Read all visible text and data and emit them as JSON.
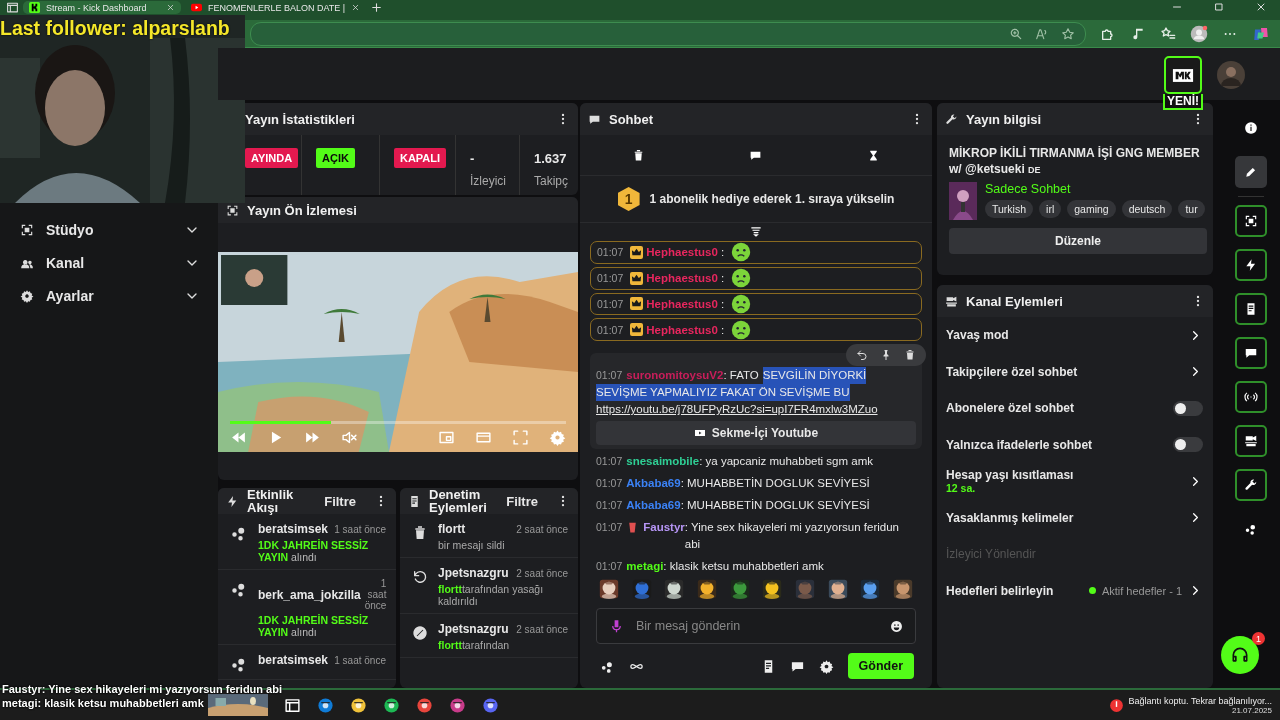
{
  "browser": {
    "tabs": [
      {
        "title": "Stream - Kick Dashboard",
        "selected": true
      },
      {
        "title": "FENOMENLERLE BALON DATE |",
        "selected": false
      }
    ]
  },
  "webcam_overlay": {
    "caption": "Last follower: alparslanb"
  },
  "header": {
    "new_badge": "YENİ!"
  },
  "sidebar": {
    "items": [
      {
        "label": "Stüdyo",
        "expanded": false
      },
      {
        "label": "Kanal",
        "expanded": false
      },
      {
        "label": "Ayarlar",
        "expanded": false
      }
    ]
  },
  "stats": {
    "title": "Yayın İstatistikleri",
    "items": [
      {
        "kind": "badge",
        "value": "AYINDA",
        "color": "#e3194f"
      },
      {
        "kind": "badge",
        "value": "AÇIK",
        "color": "#53fc18"
      },
      {
        "kind": "badge",
        "value": "KAPALI",
        "color": "#e3194f"
      },
      {
        "kind": "text",
        "value": "-",
        "label": "İzleyici"
      },
      {
        "kind": "text",
        "value": "1.637",
        "label": "Takipç"
      }
    ]
  },
  "preview": {
    "title": "Yayın Ön İzlemesi",
    "progress": {
      "level": 0.3
    }
  },
  "events": {
    "title": "Etkinlik Akışı",
    "filter": "Filtre",
    "items": [
      {
        "user": "beratsimsek",
        "time": "1 saat önce",
        "reward": "1DK JAHREİN SESSİZ YAYIN",
        "action": "alındı"
      },
      {
        "user": "berk_ama_jokzilla",
        "time": "1 saat önce",
        "reward": "1DK JAHREİN SESSİZ YAYIN",
        "action": "alındı"
      },
      {
        "user": "beratsimsek",
        "time": "1 saat önce"
      }
    ]
  },
  "moderation": {
    "title": "Denetim Eylemleri",
    "filter": "Filtre",
    "items": [
      {
        "kind": "delete",
        "user": "flortt",
        "time": "2 saat önce",
        "description": "bir mesajı sildi"
      },
      {
        "kind": "unban",
        "user": "Jpetsnazgru",
        "time": "2 saat önce",
        "actor": "flortt",
        "description": "tarafından yasağı kaldırıldı"
      },
      {
        "kind": "timeout",
        "user": "Jpetsnazgru",
        "time": "2 saat önce",
        "actor": "flortt",
        "description": "tarafından"
      }
    ]
  },
  "chat": {
    "title": "Sohbet",
    "promo_rank": "1",
    "promo": "1 abonelik hediye ederek 1. sıraya yükselin",
    "messages": [
      {
        "kind": "highlighted",
        "time": "01:07",
        "badge": {
          "kind": "crown"
        },
        "user": "Hephaestus0",
        "color": "#e8265e",
        "text": ":",
        "emote": true
      },
      {
        "kind": "highlighted",
        "time": "01:07",
        "badge": {
          "kind": "crown"
        },
        "user": "Hephaestus0",
        "color": "#e8265e",
        "text": ":",
        "emote": true
      },
      {
        "kind": "highlighted",
        "time": "01:07",
        "badge": {
          "kind": "crown"
        },
        "user": "Hephaestus0",
        "color": "#e8265e",
        "text": ":",
        "emote": true
      },
      {
        "kind": "highlighted",
        "time": "01:07",
        "badge": {
          "kind": "crown"
        },
        "user": "Hephaestus0",
        "color": "#e8265e",
        "text": ":",
        "emote": true
      },
      {
        "kind": "card",
        "time": "01:07",
        "user": "suronomitoysuV2",
        "color": "#c81e5a",
        "lines": [
          [
            {
              "text": ": FATO",
              "selected": false
            },
            {
              "text": "SEVGİLİN DİYORKİ",
              "selected": true
            }
          ],
          [
            {
              "text": "SEVİŞME YAPMALIYIZ FAKAT ÖN SEVİŞME BU",
              "selected": true
            }
          ]
        ],
        "link": "https://youtu.be/j78UFPyRzUc?si=upI7FR4mxlw3MZuo",
        "button": "Sekme-İçi Youtube"
      },
      {
        "kind": "plain",
        "time": "01:07",
        "user": "snesaimobile",
        "color": "#2fcf95",
        "text": ": ya yapcaniz muhabbeti sgm amk"
      },
      {
        "kind": "plain",
        "time": "01:07",
        "user": "Akbaba69",
        "color": "#3b82f6",
        "text": ": MUHABBETİN DOGLUK SEVİYESİ"
      },
      {
        "kind": "plain",
        "time": "01:07",
        "user": "Akbaba69",
        "color": "#3b82f6",
        "text": ": MUHABBETİN DOGLUK SEVİYESİ"
      },
      {
        "kind": "plain",
        "time": "01:07",
        "badge": {
          "kind": "cup"
        },
        "user": "Faustyr",
        "color": "#b695f5",
        "text": ": Yine sex hikayeleri mi yazıyorsun feridun abi"
      },
      {
        "kind": "plain",
        "time": "01:07",
        "user": "metagi",
        "color": "#53fc18",
        "text": ": klasik ketsu muhabbetleri amk"
      }
    ],
    "placeholder": "Bir mesaj gönderin",
    "send": "Gönder"
  },
  "stream_info": {
    "title": "Yayın bilgisi",
    "stream_title": "MİKROP İKİLİ TIRMANMA İŞİ GNG MEMBER w/ @ketsueki",
    "language": "DE",
    "category": "Sadece Sohbet",
    "tags": [
      "Turkish",
      "irl",
      "gaming",
      "deutsch",
      "tur"
    ],
    "edit": "Düzenle"
  },
  "channel_actions": {
    "title": "Kanal Eylemleri",
    "items": [
      {
        "kind": "link",
        "label": "Yavaş mod",
        "disabled": false
      },
      {
        "kind": "link",
        "label": "Takipçilere özel sohbet",
        "disabled": false
      },
      {
        "kind": "toggle",
        "label": "Abonelere özel sohbet",
        "on": false,
        "disabled": false
      },
      {
        "kind": "toggle",
        "label": "Yalnızca ifadelerle sohbet",
        "on": false,
        "disabled": false
      },
      {
        "kind": "link",
        "label": "Hesap yaşı kısıtlaması",
        "detail": "12 sa.",
        "disabled": false
      },
      {
        "kind": "link",
        "label": "Yasaklanmış kelimeler",
        "disabled": false
      },
      {
        "kind": "plain",
        "label": "İzleyici Yönlendir",
        "disabled": true
      },
      {
        "kind": "link",
        "label": "Hedefleri belirleyin",
        "status": "Aktif hedefler - 1",
        "disabled": false
      }
    ]
  },
  "rail": {
    "items": [
      {
        "selected": false,
        "outlined": false
      },
      {
        "selected": true,
        "outlined": false
      },
      {
        "selected": false,
        "outlined": true
      },
      {
        "selected": false,
        "outlined": true
      },
      {
        "selected": false,
        "outlined": true
      },
      {
        "selected": false,
        "outlined": true
      },
      {
        "selected": false,
        "outlined": true
      },
      {
        "selected": false,
        "outlined": true
      },
      {
        "selected": false,
        "outlined": true
      },
      {
        "selected": false,
        "outlined": false
      }
    ]
  },
  "support": {
    "badge": "1"
  },
  "stream_overlay": {
    "lines": [
      {
        "user": "Faustyr",
        "text": ": Yine sex hikayeleri mi yazıyorsun feridun abi"
      },
      {
        "user": "metagi",
        "text": ": klasik ketsu muhabbetleri amk"
      }
    ]
  },
  "taskbar": {
    "status": "Bağlantı koptu. Tekrar bağlanılıyor...",
    "date": "21.07.2025"
  }
}
